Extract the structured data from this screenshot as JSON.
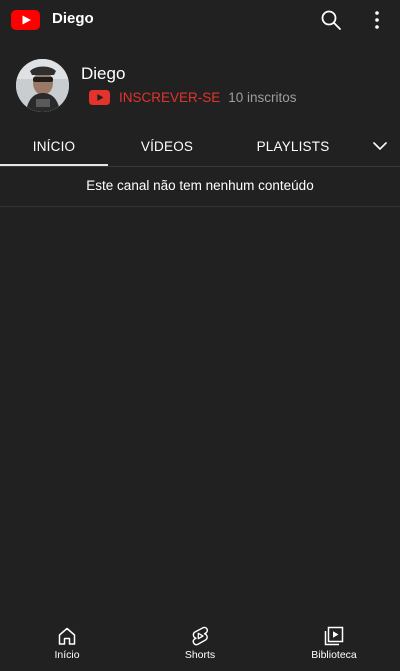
{
  "topbar": {
    "title": "Diego",
    "logo_icon": "youtube-logo-icon",
    "search_icon": "search-icon",
    "more_icon": "more-vertical-icon",
    "brand_color": "#ff0000"
  },
  "channel": {
    "name": "Diego",
    "subscribe_label": "INSCREVER-SE",
    "subscriber_count": "10 inscritos",
    "subscribe_color": "#e5322d"
  },
  "tabs": [
    {
      "label": "INÍCIO",
      "active": true
    },
    {
      "label": "VÍDEOS",
      "active": false
    },
    {
      "label": "PLAYLISTS",
      "active": false
    }
  ],
  "empty_message": "Este canal não tem nenhum conteúdo",
  "bottom_nav": [
    {
      "label": "Início",
      "icon": "home-icon"
    },
    {
      "label": "Shorts",
      "icon": "shorts-icon"
    },
    {
      "label": "Biblioteca",
      "icon": "library-icon"
    }
  ]
}
